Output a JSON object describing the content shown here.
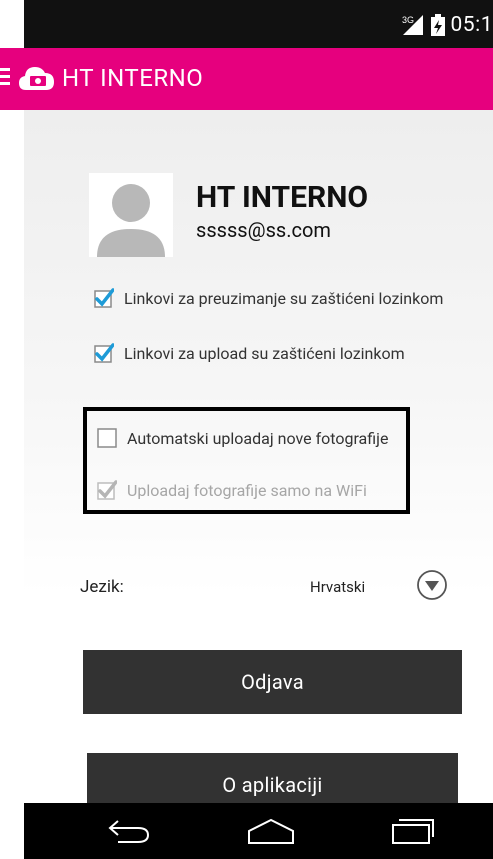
{
  "status_bar": {
    "network": "3G",
    "time": "05:1"
  },
  "app_bar": {
    "title": "HT INTERNO"
  },
  "profile": {
    "name": "HT INTERNO",
    "email": "sssss@ss.com"
  },
  "settings": [
    {
      "label": "Linkovi za preuzimanje su zaštićeni lozinkom",
      "checked": true,
      "enabled": true
    },
    {
      "label": "Linkovi za upload su zaštićeni lozinkom",
      "checked": true,
      "enabled": true
    },
    {
      "label": "Automatski uploadaj nove fotografije",
      "checked": false,
      "enabled": true
    },
    {
      "label": "Uploadaj fotografije samo na WiFi",
      "checked": true,
      "enabled": false
    }
  ],
  "language": {
    "label": "Jezik:",
    "value": "Hrvatski"
  },
  "buttons": {
    "logout": "Odjava",
    "about": "O aplikaciji"
  },
  "colors": {
    "brand": "#e6007e",
    "check": "#1e9bd7",
    "button": "#323232"
  },
  "icons": {
    "menu": "menu-icon",
    "logo": "cloud-logo-icon",
    "back": "back-icon",
    "home": "home-icon",
    "recents": "recents-icon"
  }
}
